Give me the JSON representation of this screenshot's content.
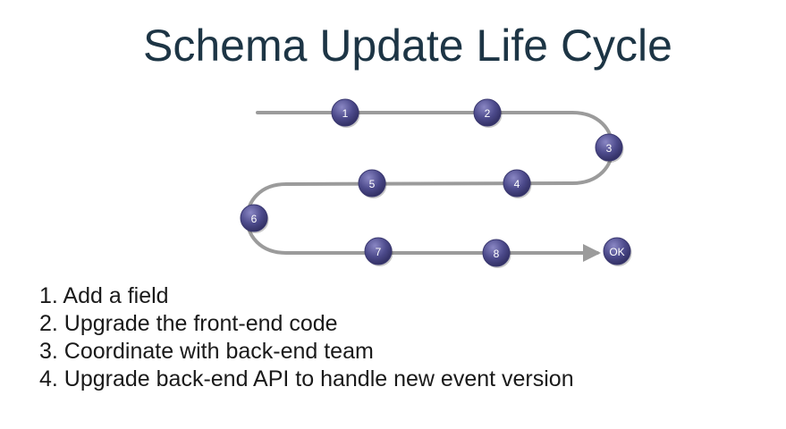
{
  "title": "Schema Update Life Cycle",
  "path": {
    "line_color": "#9b9b9b",
    "node_color": "#4d4b8c",
    "nodes": [
      {
        "label": "1"
      },
      {
        "label": "2"
      },
      {
        "label": "3"
      },
      {
        "label": "4"
      },
      {
        "label": "5"
      },
      {
        "label": "6"
      },
      {
        "label": "7"
      },
      {
        "label": "8"
      },
      {
        "label": "OK"
      }
    ]
  },
  "steps": [
    {
      "text": "1. Add a field"
    },
    {
      "text": "2. Upgrade the front-end code"
    },
    {
      "text": "3. Coordinate with back-end team"
    },
    {
      "text": "4. Upgrade back-end API to handle new event version"
    }
  ]
}
